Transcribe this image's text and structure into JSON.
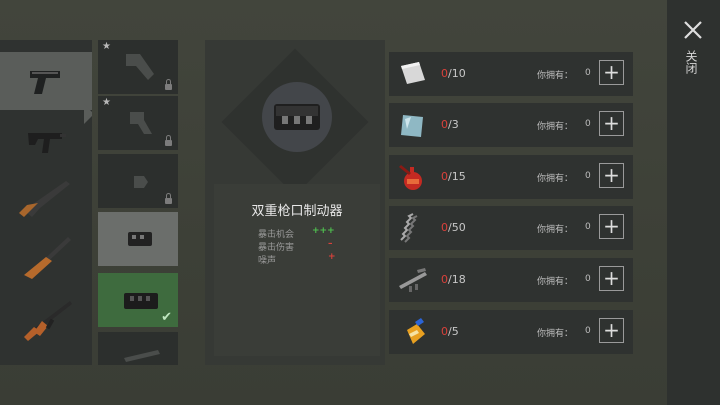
{
  "item": {
    "name": "双重枪口制动器",
    "stats": [
      {
        "label": "暴击机会",
        "value": "+++",
        "color": "#4fbf4f"
      },
      {
        "label": "暴击伤害",
        "value": "–",
        "color": "#d9413b"
      },
      {
        "label": "噪声",
        "value": "+",
        "color": "#d9413b"
      }
    ]
  },
  "owned_label": "你拥有：",
  "requirements": [
    {
      "icon": "metal-sheet-icon",
      "current": "0",
      "needed": "/10",
      "owned": "0"
    },
    {
      "icon": "glass-plate-icon",
      "current": "0",
      "needed": "/3",
      "owned": "0"
    },
    {
      "icon": "oil-can-icon",
      "current": "0",
      "needed": "/15",
      "owned": "0"
    },
    {
      "icon": "spring-icon",
      "current": "0",
      "needed": "/50",
      "owned": "0"
    },
    {
      "icon": "rifle-parts-icon",
      "current": "0",
      "needed": "/18",
      "owned": "0"
    },
    {
      "icon": "glue-bottle-icon",
      "current": "0",
      "needed": "/5",
      "owned": "0"
    }
  ],
  "plus_label": "+",
  "close_label": "关闭",
  "weapons": [
    "pistol-icon",
    "smg-icon",
    "shotgun-icon",
    "hunting-rifle-icon",
    "assault-rifle-icon",
    "sniper-rifle-icon"
  ],
  "mod_slots": [
    {
      "icon": "stock-icon",
      "starred": true,
      "locked": true
    },
    {
      "icon": "grip-icon",
      "starred": true,
      "locked": true
    },
    {
      "icon": "scope-mount-icon",
      "starred": false,
      "locked": true
    },
    {
      "icon": "muzzle-brake-icon",
      "starred": false,
      "locked": false
    },
    {
      "icon": "double-muzzle-brake-icon",
      "starred": false,
      "locked": false,
      "equipped": true
    },
    {
      "icon": "barrel-icon",
      "starred": false,
      "locked": false
    }
  ]
}
